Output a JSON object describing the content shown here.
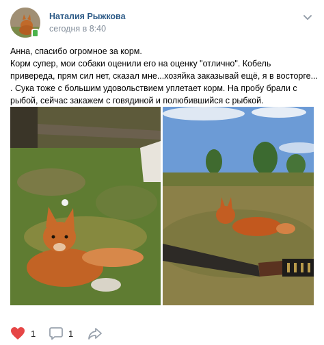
{
  "post": {
    "author": "Наталия Рыжкова",
    "time": "сегодня в 8:40",
    "text_lines": [
      "Анна, спасибо огромное за корм.",
      "Корм супер, мои собаки оценили его на оценку \"отлично\". Кобель привереда, прям сил нет, сказал мне...хозяйка заказывай ещё, я в восторге... . Сука тоже с большим удовольствием уплетает корм. На пробу брали с рыбой, сейчас закажем с говядиной и полюбившийся с рыбкой."
    ]
  },
  "photos": [
    {
      "description_icon": "dog-in-forest-photo"
    },
    {
      "description_icon": "dog-in-field-with-gun-photo"
    }
  ],
  "actions": {
    "likes": "1",
    "comments": "1",
    "like_color": "#e64646"
  },
  "colors": {
    "author": "#2a5885",
    "secondary": "#818c99",
    "icon": "#99a2ad"
  }
}
